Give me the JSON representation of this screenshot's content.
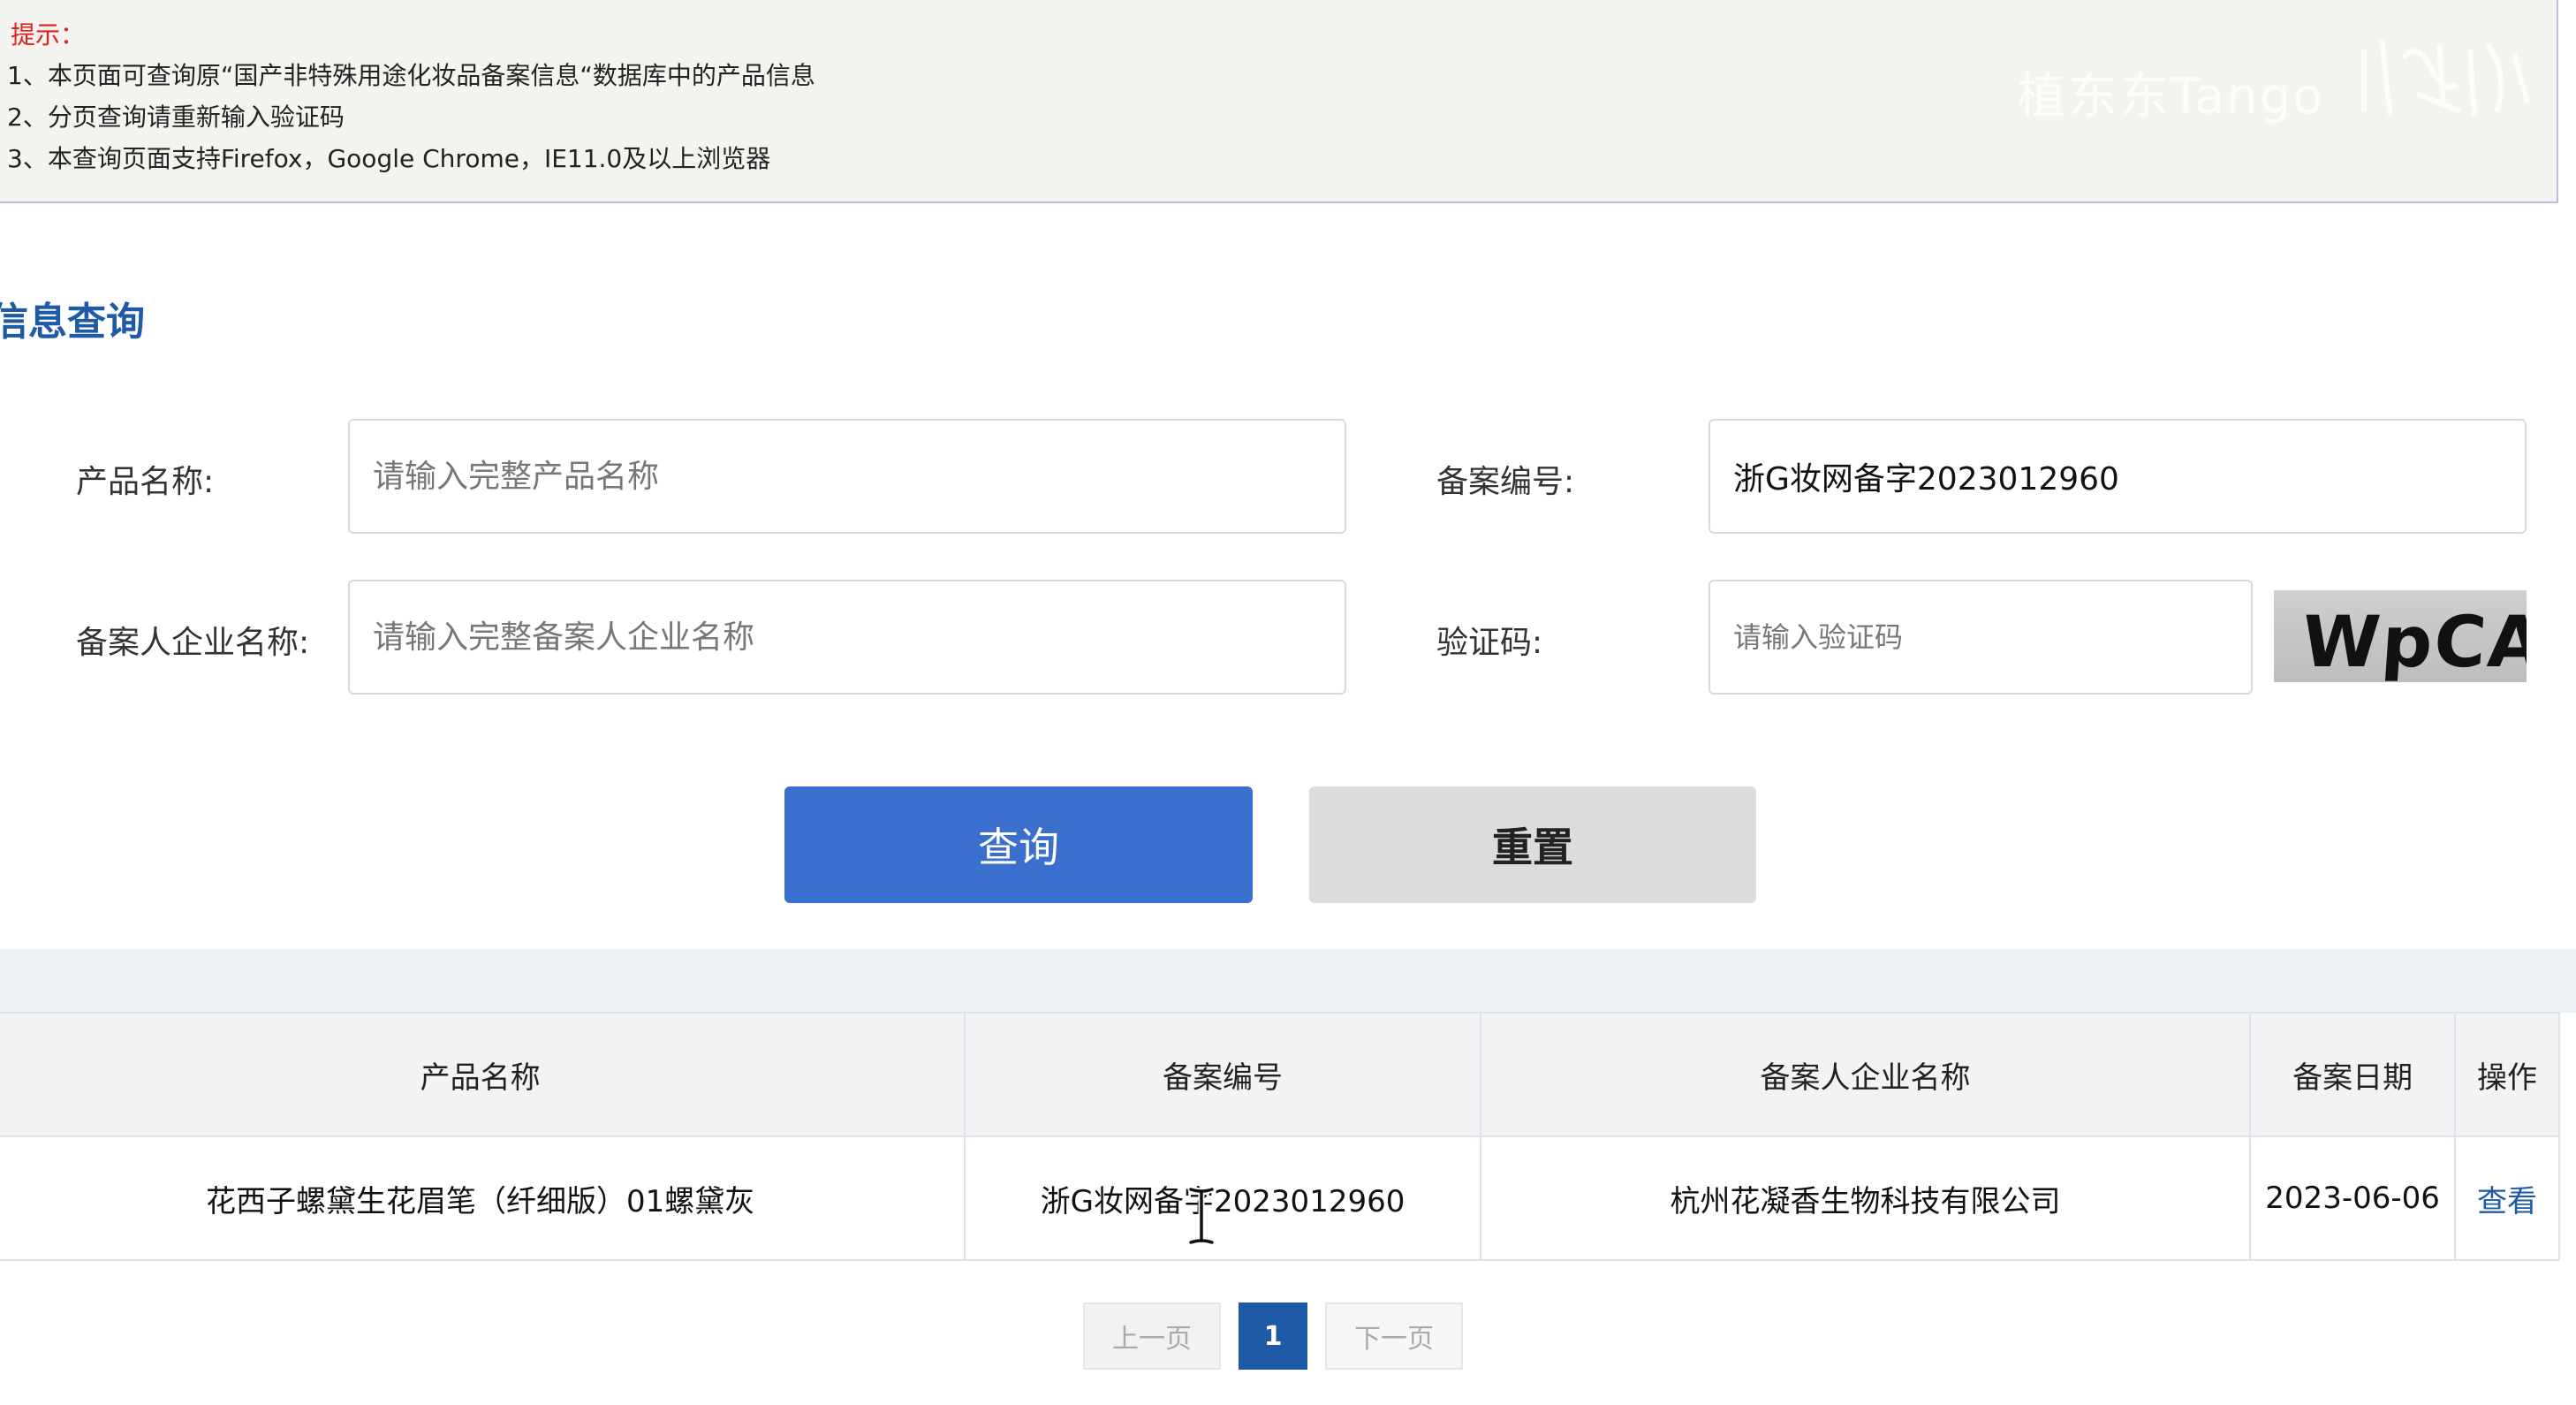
{
  "notice": {
    "title": "提示：",
    "lines": [
      "1、本页面可查询原“国产非特殊用途化妆品备案信息“数据库中的产品信息",
      "2、分页查询请重新输入验证码",
      "3、本查询页面支持Firefox，Google Chrome，IE11.0及以上浏览器"
    ],
    "watermark": "植东东Tango"
  },
  "section_title": "信息查询",
  "form": {
    "product_name_label": "产品名称:",
    "product_name_placeholder": "请输入完整产品名称",
    "product_name_value": "",
    "record_no_label": "备案编号:",
    "record_no_value": "浙G妆网备字2023012960",
    "company_label": "备案人企业名称:",
    "company_placeholder": "请输入完整备案人企业名称",
    "company_value": "",
    "captcha_label": "验证码:",
    "captcha_placeholder": "请输入验证码",
    "captcha_value": "",
    "captcha_image_text": "WpCA"
  },
  "buttons": {
    "query": "查询",
    "reset": "重置"
  },
  "table": {
    "headers": [
      "产品名称",
      "备案编号",
      "备案人企业名称",
      "备案日期",
      "操作"
    ],
    "rows": [
      {
        "product": "花西子螺黛生花眉笔（纤细版）01螺黛灰",
        "record_no": "浙G妆网备字2023012960",
        "company": "杭州花凝香生物科技有限公司",
        "date": "2023-06-06",
        "action": "查看"
      }
    ]
  },
  "pagination": {
    "prev": "上一页",
    "current": "1",
    "next": "下一页"
  },
  "colors": {
    "primary": "#3a6fce",
    "heading": "#1f5aa6",
    "hint_red": "#e02020",
    "reset_bg": "#dcdcdc"
  }
}
